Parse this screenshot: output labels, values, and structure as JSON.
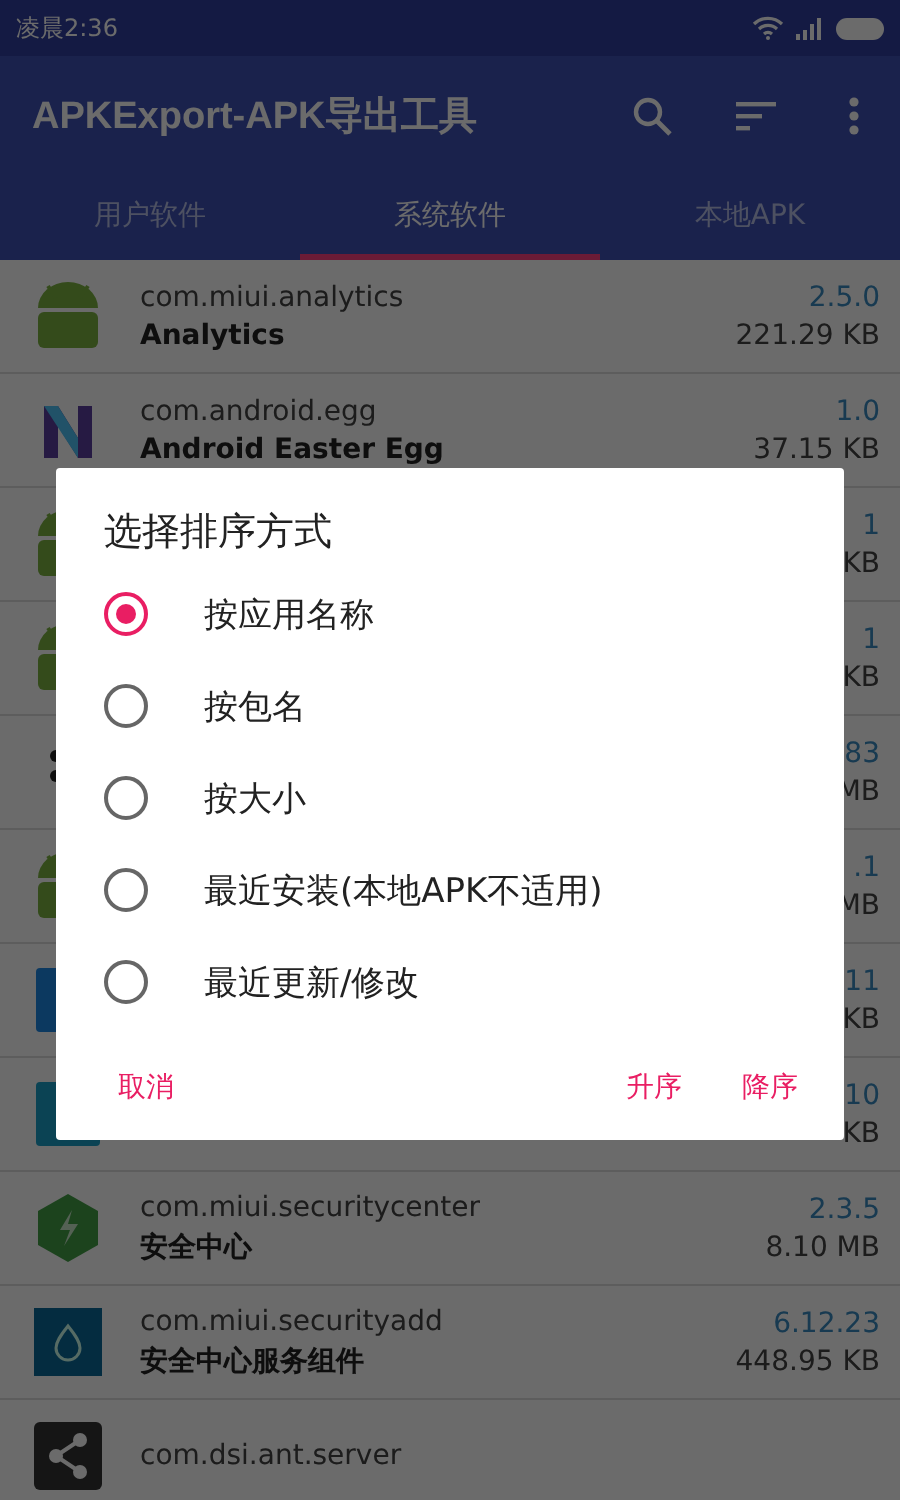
{
  "status_bar": {
    "time": "凌晨2:36"
  },
  "app_bar": {
    "title": "APKExport-APK导出工具"
  },
  "tabs": [
    {
      "label": "用户软件",
      "selected": false
    },
    {
      "label": "系统软件",
      "selected": true
    },
    {
      "label": "本地APK",
      "selected": false
    }
  ],
  "apps": [
    {
      "package": "com.miui.analytics",
      "name": "Analytics",
      "version": "2.5.0",
      "size": "221.29 KB"
    },
    {
      "package": "com.android.egg",
      "name": "Android Easter Egg",
      "version": "1.0",
      "size": "37.15 KB"
    },
    {
      "version": "1",
      "size": "KB"
    },
    {
      "version": "1",
      "size": "KB"
    },
    {
      "version": "83",
      "size": "MB"
    },
    {
      "version": ".1",
      "size": "MB"
    },
    {
      "version": "11",
      "size": "KB"
    },
    {
      "version": "10",
      "size": "KB"
    },
    {
      "package": "com.miui.securitycenter",
      "name": "安全中心",
      "version": "2.3.5",
      "size": "8.10 MB"
    },
    {
      "package": "com.miui.securityadd",
      "name": "安全中心服务组件",
      "version": "6.12.23",
      "size": "448.95 KB"
    },
    {
      "package": "com.dsi.ant.server"
    }
  ],
  "dialog": {
    "title": "选择排序方式",
    "options": [
      {
        "label": "按应用名称",
        "selected": true
      },
      {
        "label": "按包名",
        "selected": false
      },
      {
        "label": "按大小",
        "selected": false
      },
      {
        "label": "最近安装(本地APK不适用)",
        "selected": false
      },
      {
        "label": "最近更新/修改",
        "selected": false
      }
    ],
    "buttons": [
      "取消",
      "升序",
      "降序"
    ]
  }
}
